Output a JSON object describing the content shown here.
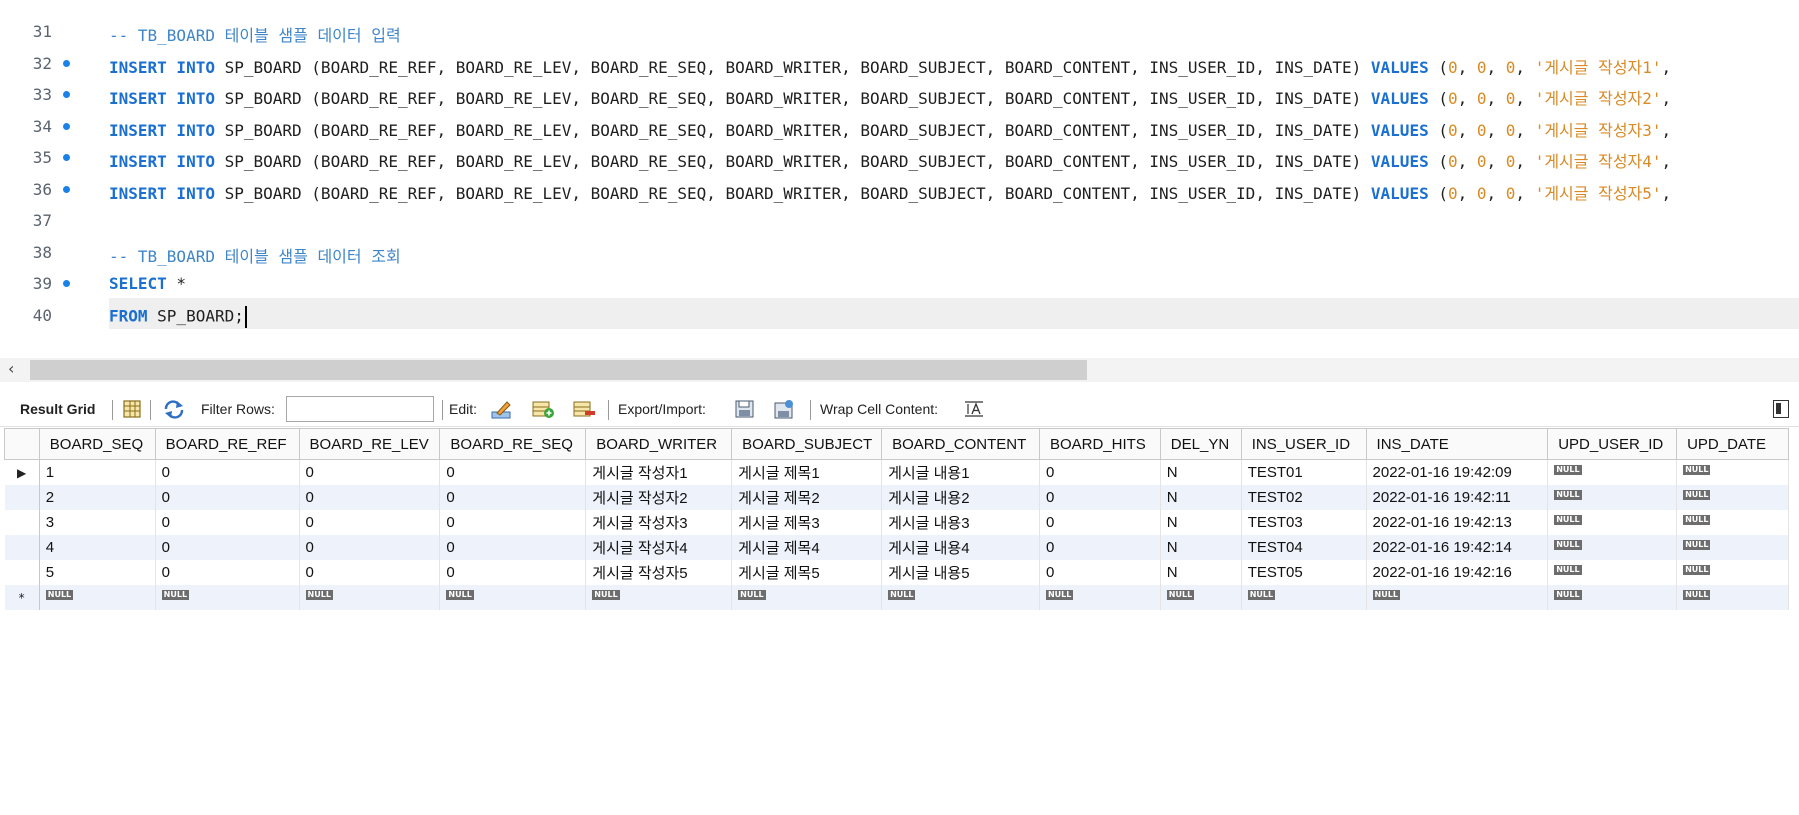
{
  "editor": {
    "lines": [
      {
        "num": "31",
        "bp": false,
        "tokens": [
          {
            "t": "cm",
            "v": "-- TB_BOARD 테이블 샘플 데이터 입력"
          }
        ]
      },
      {
        "num": "32",
        "bp": true,
        "tokens": [
          {
            "t": "kw",
            "v": "INSERT INTO"
          },
          {
            "t": "pl",
            "v": " SP_BOARD (BOARD_RE_REF, BOARD_RE_LEV, BOARD_RE_SEQ, BOARD_WRITER, BOARD_SUBJECT, BOARD_CONTENT, INS_USER_ID, INS_DATE) "
          },
          {
            "t": "kw",
            "v": "VALUES"
          },
          {
            "t": "pl",
            "v": " ("
          },
          {
            "t": "num",
            "v": "0"
          },
          {
            "t": "pl",
            "v": ", "
          },
          {
            "t": "num",
            "v": "0"
          },
          {
            "t": "pl",
            "v": ", "
          },
          {
            "t": "num",
            "v": "0"
          },
          {
            "t": "pl",
            "v": ", "
          },
          {
            "t": "str",
            "v": "'게시글 작성자1'"
          },
          {
            "t": "pl",
            "v": ","
          }
        ]
      },
      {
        "num": "33",
        "bp": true,
        "tokens": [
          {
            "t": "kw",
            "v": "INSERT INTO"
          },
          {
            "t": "pl",
            "v": " SP_BOARD (BOARD_RE_REF, BOARD_RE_LEV, BOARD_RE_SEQ, BOARD_WRITER, BOARD_SUBJECT, BOARD_CONTENT, INS_USER_ID, INS_DATE) "
          },
          {
            "t": "kw",
            "v": "VALUES"
          },
          {
            "t": "pl",
            "v": " ("
          },
          {
            "t": "num",
            "v": "0"
          },
          {
            "t": "pl",
            "v": ", "
          },
          {
            "t": "num",
            "v": "0"
          },
          {
            "t": "pl",
            "v": ", "
          },
          {
            "t": "num",
            "v": "0"
          },
          {
            "t": "pl",
            "v": ", "
          },
          {
            "t": "str",
            "v": "'게시글 작성자2'"
          },
          {
            "t": "pl",
            "v": ","
          }
        ]
      },
      {
        "num": "34",
        "bp": true,
        "tokens": [
          {
            "t": "kw",
            "v": "INSERT INTO"
          },
          {
            "t": "pl",
            "v": " SP_BOARD (BOARD_RE_REF, BOARD_RE_LEV, BOARD_RE_SEQ, BOARD_WRITER, BOARD_SUBJECT, BOARD_CONTENT, INS_USER_ID, INS_DATE) "
          },
          {
            "t": "kw",
            "v": "VALUES"
          },
          {
            "t": "pl",
            "v": " ("
          },
          {
            "t": "num",
            "v": "0"
          },
          {
            "t": "pl",
            "v": ", "
          },
          {
            "t": "num",
            "v": "0"
          },
          {
            "t": "pl",
            "v": ", "
          },
          {
            "t": "num",
            "v": "0"
          },
          {
            "t": "pl",
            "v": ", "
          },
          {
            "t": "str",
            "v": "'게시글 작성자3'"
          },
          {
            "t": "pl",
            "v": ","
          }
        ]
      },
      {
        "num": "35",
        "bp": true,
        "tokens": [
          {
            "t": "kw",
            "v": "INSERT INTO"
          },
          {
            "t": "pl",
            "v": " SP_BOARD (BOARD_RE_REF, BOARD_RE_LEV, BOARD_RE_SEQ, BOARD_WRITER, BOARD_SUBJECT, BOARD_CONTENT, INS_USER_ID, INS_DATE) "
          },
          {
            "t": "kw",
            "v": "VALUES"
          },
          {
            "t": "pl",
            "v": " ("
          },
          {
            "t": "num",
            "v": "0"
          },
          {
            "t": "pl",
            "v": ", "
          },
          {
            "t": "num",
            "v": "0"
          },
          {
            "t": "pl",
            "v": ", "
          },
          {
            "t": "num",
            "v": "0"
          },
          {
            "t": "pl",
            "v": ", "
          },
          {
            "t": "str",
            "v": "'게시글 작성자4'"
          },
          {
            "t": "pl",
            "v": ","
          }
        ]
      },
      {
        "num": "36",
        "bp": true,
        "tokens": [
          {
            "t": "kw",
            "v": "INSERT INTO"
          },
          {
            "t": "pl",
            "v": " SP_BOARD (BOARD_RE_REF, BOARD_RE_LEV, BOARD_RE_SEQ, BOARD_WRITER, BOARD_SUBJECT, BOARD_CONTENT, INS_USER_ID, INS_DATE) "
          },
          {
            "t": "kw",
            "v": "VALUES"
          },
          {
            "t": "pl",
            "v": " ("
          },
          {
            "t": "num",
            "v": "0"
          },
          {
            "t": "pl",
            "v": ", "
          },
          {
            "t": "num",
            "v": "0"
          },
          {
            "t": "pl",
            "v": ", "
          },
          {
            "t": "num",
            "v": "0"
          },
          {
            "t": "pl",
            "v": ", "
          },
          {
            "t": "str",
            "v": "'게시글 작성자5'"
          },
          {
            "t": "pl",
            "v": ","
          }
        ]
      },
      {
        "num": "37",
        "bp": false,
        "tokens": []
      },
      {
        "num": "38",
        "bp": false,
        "tokens": [
          {
            "t": "cm",
            "v": "-- TB_BOARD 테이블 샘플 데이터 조회"
          }
        ]
      },
      {
        "num": "39",
        "bp": true,
        "tokens": [
          {
            "t": "kw",
            "v": "SELECT"
          },
          {
            "t": "pl",
            "v": " *"
          }
        ]
      },
      {
        "num": "40",
        "bp": false,
        "current": true,
        "tokens": [
          {
            "t": "kw",
            "v": "FROM"
          },
          {
            "t": "pl",
            "v": " SP_BOARD;"
          }
        ]
      }
    ]
  },
  "toolbar": {
    "result_grid_label": "Result Grid",
    "filter_rows_label": "Filter Rows:",
    "filter_rows_value": "",
    "edit_label": "Edit:",
    "export_import_label": "Export/Import:",
    "wrap_cell_label": "Wrap Cell Content:"
  },
  "grid": {
    "null_text": "NULL",
    "columns": [
      "BOARD_SEQ",
      "BOARD_RE_REF",
      "BOARD_RE_LEV",
      "BOARD_RE_SEQ",
      "BOARD_WRITER",
      "BOARD_SUBJECT",
      "BOARD_CONTENT",
      "BOARD_HITS",
      "DEL_YN",
      "INS_USER_ID",
      "INS_DATE",
      "UPD_USER_ID",
      "UPD_DATE"
    ],
    "rows": [
      [
        "1",
        "0",
        "0",
        "0",
        "게시글 작성자1",
        "게시글 제목1",
        "게시글 내용1",
        "0",
        "N",
        "TEST01",
        "2022-01-16 19:42:09",
        null,
        null
      ],
      [
        "2",
        "0",
        "0",
        "0",
        "게시글 작성자2",
        "게시글 제목2",
        "게시글 내용2",
        "0",
        "N",
        "TEST02",
        "2022-01-16 19:42:11",
        null,
        null
      ],
      [
        "3",
        "0",
        "0",
        "0",
        "게시글 작성자3",
        "게시글 제목3",
        "게시글 내용3",
        "0",
        "N",
        "TEST03",
        "2022-01-16 19:42:13",
        null,
        null
      ],
      [
        "4",
        "0",
        "0",
        "0",
        "게시글 작성자4",
        "게시글 제목4",
        "게시글 내용4",
        "0",
        "N",
        "TEST04",
        "2022-01-16 19:42:14",
        null,
        null
      ],
      [
        "5",
        "0",
        "0",
        "0",
        "게시글 작성자5",
        "게시글 제목5",
        "게시글 내용5",
        "0",
        "N",
        "TEST05",
        "2022-01-16 19:42:16",
        null,
        null
      ]
    ],
    "current_row_marker": "▶",
    "new_row_marker": "*"
  }
}
